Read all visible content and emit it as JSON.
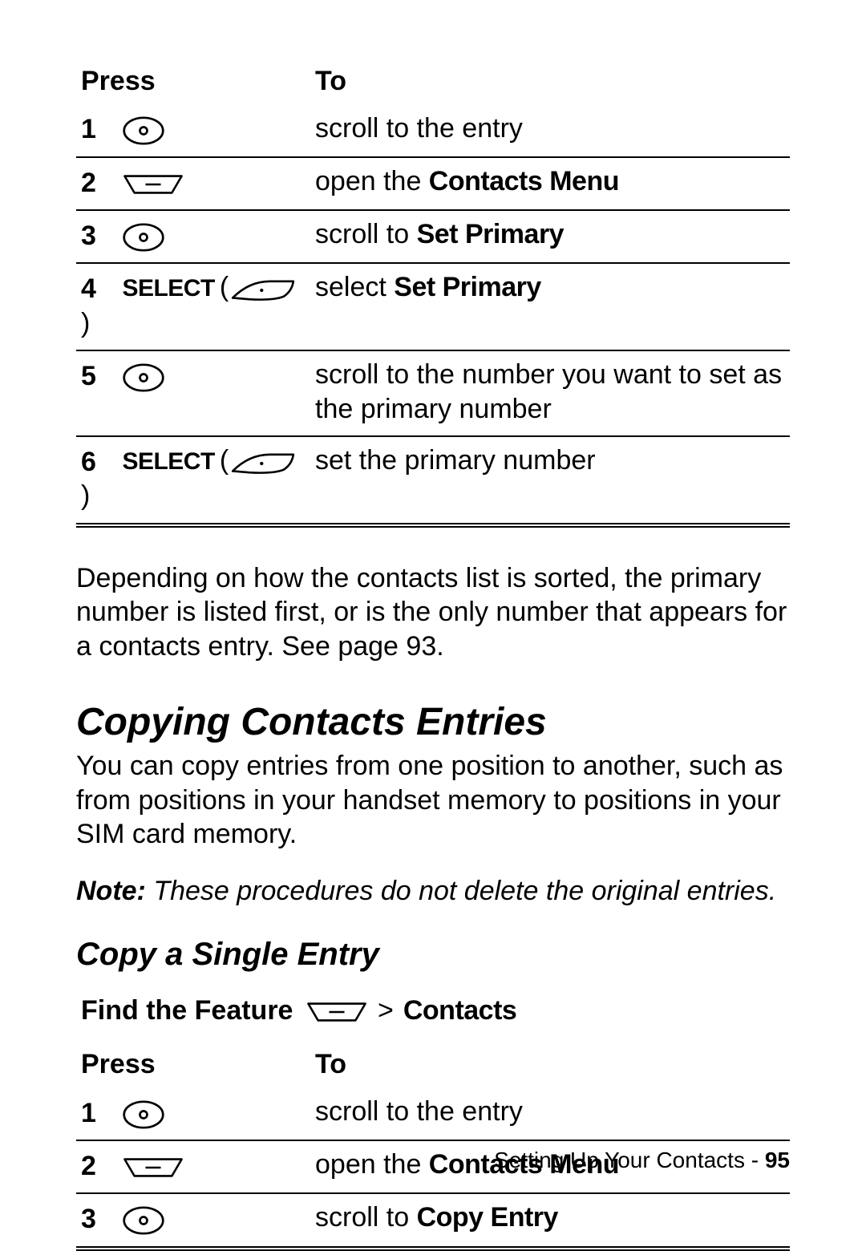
{
  "table1": {
    "head_press": "Press",
    "head_to": "To",
    "rows": [
      {
        "num": "1",
        "key": "nav",
        "to_pre": "scroll to the entry",
        "to_bold": ""
      },
      {
        "num": "2",
        "key": "menu",
        "to_pre": "open the ",
        "to_bold": "Contacts Menu"
      },
      {
        "num": "3",
        "key": "nav",
        "to_pre": "scroll to ",
        "to_bold": "Set Primary"
      },
      {
        "num": "4",
        "key": "select",
        "to_pre": "select ",
        "to_bold": "Set Primary"
      },
      {
        "num": "5",
        "key": "nav",
        "to_pre": "scroll to the number you want to set as the primary number",
        "to_bold": ""
      },
      {
        "num": "6",
        "key": "select",
        "to_pre": "set the primary number",
        "to_bold": ""
      }
    ],
    "select_label": "SELECT"
  },
  "paragraph1": "Depending on how the contacts list is sorted, the primary number is listed first, or is the only number that appears for a contacts entry. See page 93.",
  "section_title": "Copying Contacts Entries",
  "section_intro": "You can copy entries from one position to another, such as from positions in your handset memory to positions in your SIM card memory.",
  "note_label": "Note:",
  "note_text": " These procedures do not delete the original entries.",
  "subsection_title": "Copy a Single Entry",
  "feature_label": "Find the Feature",
  "feature_gt": ">",
  "feature_target": "Contacts",
  "table2": {
    "head_press": "Press",
    "head_to": "To",
    "rows": [
      {
        "num": "1",
        "key": "nav",
        "to_pre": "scroll to the entry",
        "to_bold": ""
      },
      {
        "num": "2",
        "key": "menu",
        "to_pre": "open the ",
        "to_bold": "Contacts Menu"
      },
      {
        "num": "3",
        "key": "nav",
        "to_pre": "scroll to ",
        "to_bold": "Copy Entry"
      }
    ]
  },
  "footer_text": "Setting Up Your Contacts - ",
  "footer_page": "95"
}
